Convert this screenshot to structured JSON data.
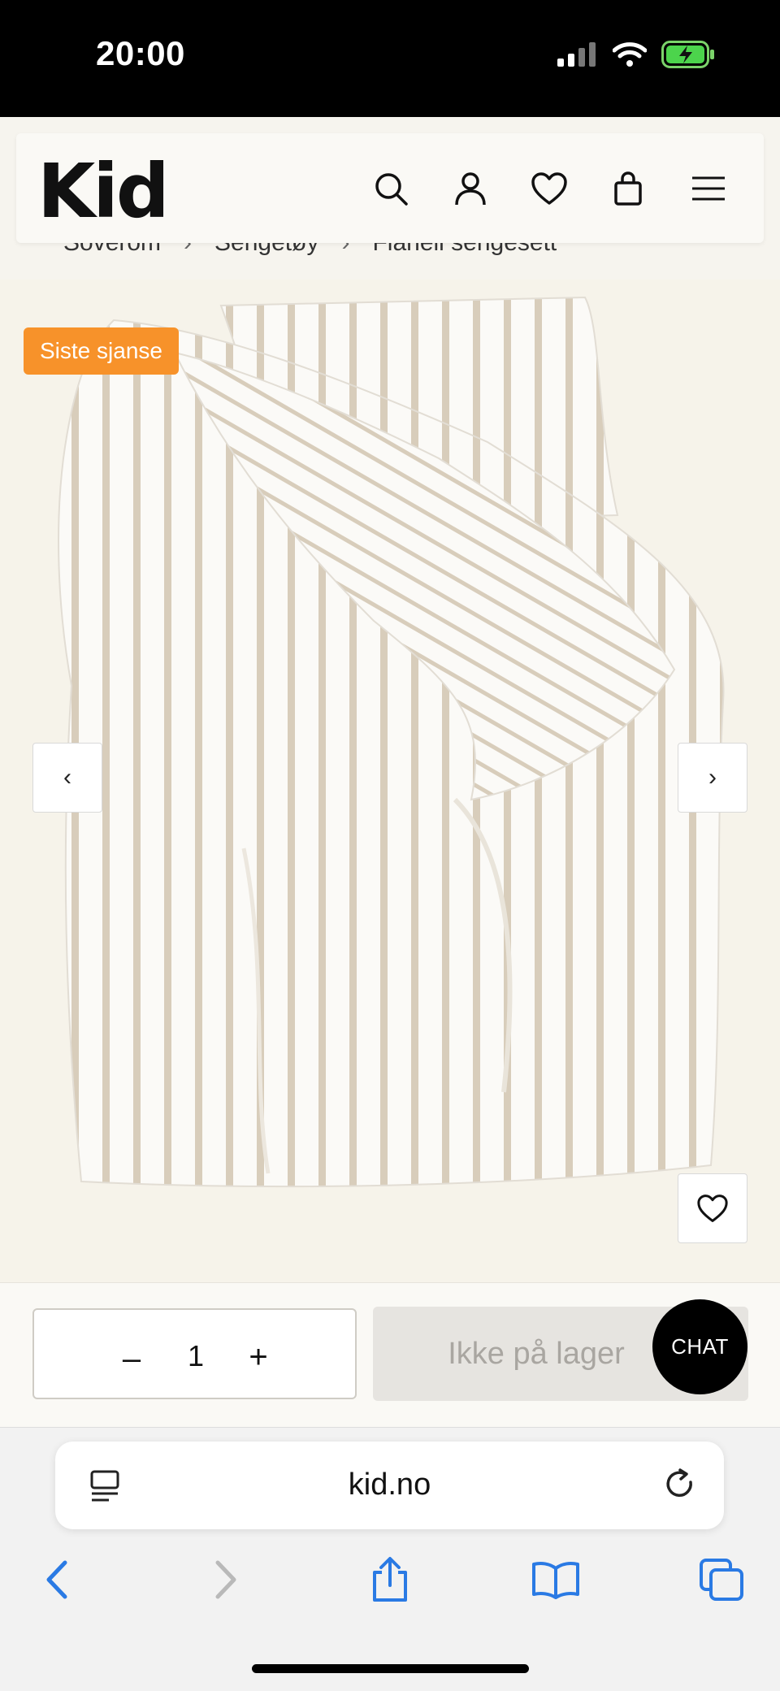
{
  "status_bar": {
    "time": "20:00"
  },
  "header": {
    "logo": "Kid"
  },
  "breadcrumb": {
    "items": [
      "Soverom",
      "Sengetøy",
      "Flanell sengesett"
    ],
    "separator": "›"
  },
  "product": {
    "badge": "Siste sjanse",
    "prev_glyph": "‹",
    "next_glyph": "›"
  },
  "purchase": {
    "quantity": "1",
    "minus": "–",
    "plus": "+",
    "cart_label": "Ikke på lager",
    "chat_label": "CHAT"
  },
  "browser": {
    "url": "kid.no"
  },
  "colors": {
    "badge": "#f7922a",
    "ios_blue": "#2a7ae4",
    "stripe": "#d8cdbb"
  },
  "icons": [
    "search-icon",
    "user-icon",
    "heart-icon",
    "bag-icon",
    "menu-icon",
    "reader-icon",
    "reload-icon",
    "back-icon",
    "forward-icon",
    "share-icon",
    "bookmarks-icon",
    "tabs-icon"
  ]
}
